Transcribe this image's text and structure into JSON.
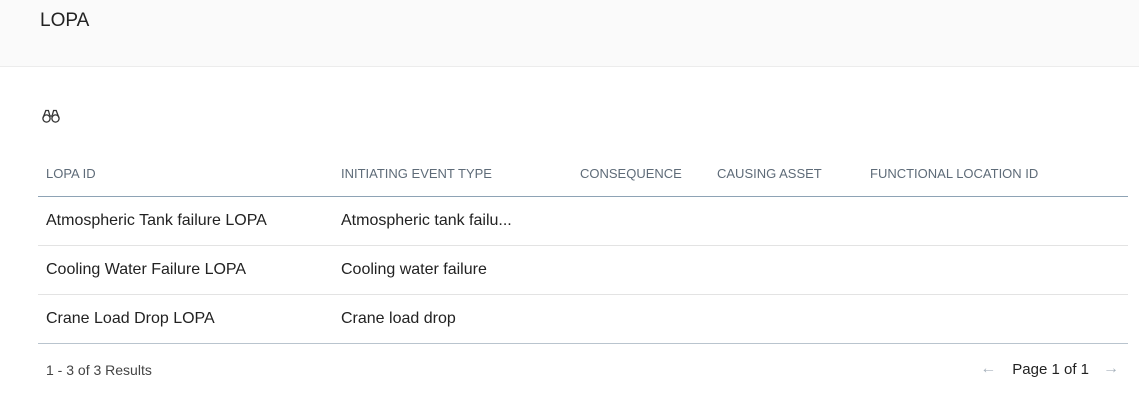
{
  "header": {
    "title": "LOPA"
  },
  "toolbar": {
    "search_icon": "binoculars-icon"
  },
  "table": {
    "columns": [
      "LOPA ID",
      "INITIATING EVENT TYPE",
      "CONSEQUENCE",
      "CAUSING ASSET",
      "FUNCTIONAL LOCATION ID"
    ],
    "rows": [
      {
        "lopa_id": "Atmospheric Tank failure LOPA",
        "event_type": "Atmospheric tank failu...",
        "consequence": "",
        "causing_asset": "",
        "functional_location_id": ""
      },
      {
        "lopa_id": "Cooling Water Failure LOPA",
        "event_type": "Cooling water failure",
        "consequence": "",
        "causing_asset": "",
        "functional_location_id": ""
      },
      {
        "lopa_id": "Crane Load Drop LOPA",
        "event_type": "Crane load drop",
        "consequence": "",
        "causing_asset": "",
        "functional_location_id": ""
      }
    ]
  },
  "footer": {
    "results_text": "1 - 3 of 3 Results",
    "page_text": "Page 1 of 1",
    "prev_icon": "arrow-left-icon",
    "next_icon": "arrow-right-icon"
  },
  "colors": {
    "header_bg": "#fafafa",
    "header_label": "#5e6b78",
    "header_rule": "#8ea3b5",
    "row_rule": "#e3e3e3",
    "arrow_disabled": "#a8b3bd"
  }
}
